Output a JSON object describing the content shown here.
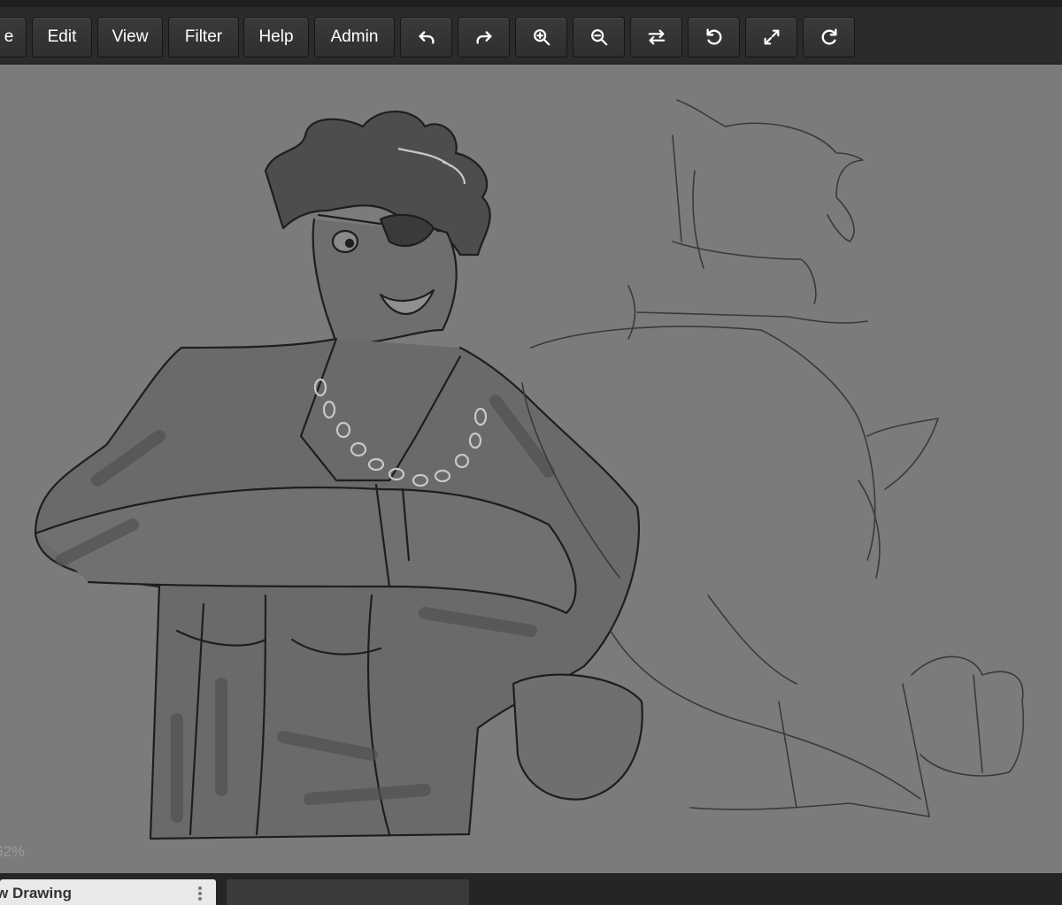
{
  "menu": {
    "file_label": "e",
    "edit_label": "Edit",
    "view_label": "View",
    "filter_label": "Filter",
    "help_label": "Help",
    "admin_label": "Admin"
  },
  "tools": {
    "undo": "undo-icon",
    "redo": "redo-icon",
    "zoom_in": "zoom-in-icon",
    "zoom_out": "zoom-out-icon",
    "flip": "flip-horizontal-icon",
    "rotate_left": "rotate-left-icon",
    "fullscreen": "fullscreen-icon",
    "rotate_right": "rotate-right-icon"
  },
  "canvas": {
    "zoom_label": "62%"
  },
  "tabs": {
    "active_label": "w Drawing"
  },
  "colors": {
    "toolbar_bg": "#2b2b2b",
    "canvas_bg": "#7b7b7b",
    "button_text": "#ffffff"
  }
}
